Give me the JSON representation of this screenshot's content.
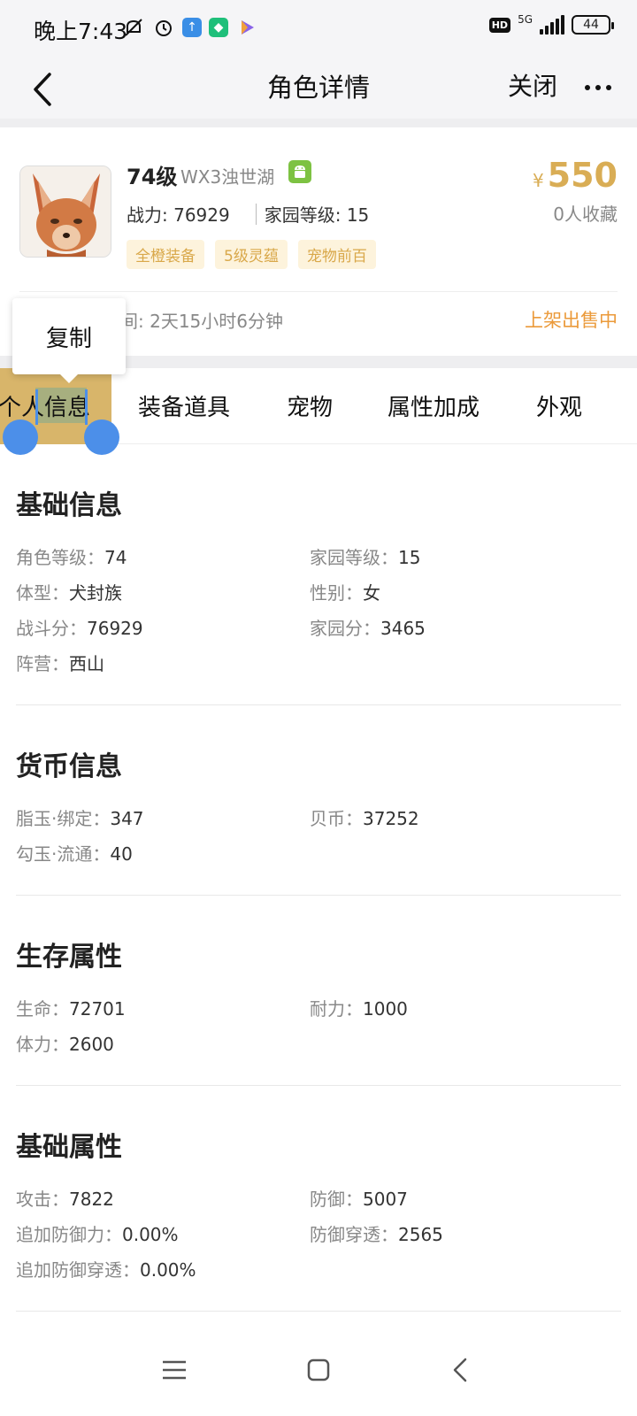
{
  "status_bar": {
    "time": "晚上7:43",
    "hd": "HD",
    "network": "5G",
    "battery": "44"
  },
  "nav": {
    "title": "角色详情",
    "close_label": "关闭"
  },
  "role": {
    "level": "74级",
    "server": "WX3浊世湖",
    "power": "战力: 76929",
    "home_level": "家园等级: 15",
    "tags": [
      "全橙装备",
      "5级灵蕴",
      "宠物前百"
    ],
    "price_symbol": "¥",
    "price": "550",
    "favorites": "0人收藏",
    "listing_time": "间: 2天15小时6分钟",
    "listing_status": "上架出售中"
  },
  "copy_popup": {
    "label": "复制"
  },
  "tabs": {
    "items": [
      "个人信息",
      "装备道具",
      "宠物",
      "属性加成",
      "外观"
    ],
    "active_part1": "个人",
    "active_part2": "信息"
  },
  "sections": [
    {
      "title": "基础信息",
      "rows": [
        [
          {
            "k": "角色等级：",
            "v": "74"
          },
          {
            "k": "家园等级：",
            "v": "15"
          }
        ],
        [
          {
            "k": "体型：",
            "v": "犬封族"
          },
          {
            "k": "性别：",
            "v": "女"
          }
        ],
        [
          {
            "k": "战斗分：",
            "v": "76929"
          },
          {
            "k": "家园分：",
            "v": "3465"
          }
        ],
        [
          {
            "k": "阵营：",
            "v": "西山"
          }
        ]
      ]
    },
    {
      "title": "货币信息",
      "rows": [
        [
          {
            "k": "脂玉·绑定：",
            "v": "347"
          },
          {
            "k": "贝币：",
            "v": "37252"
          }
        ],
        [
          {
            "k": "勾玉·流通：",
            "v": "40"
          }
        ]
      ]
    },
    {
      "title": "生存属性",
      "rows": [
        [
          {
            "k": "生命：",
            "v": "72701"
          },
          {
            "k": "耐力：",
            "v": "1000"
          }
        ],
        [
          {
            "k": "体力：",
            "v": "2600"
          }
        ]
      ]
    },
    {
      "title": "基础属性",
      "rows": [
        [
          {
            "k": "攻击：",
            "v": "7822"
          },
          {
            "k": "防御：",
            "v": "5007"
          }
        ],
        [
          {
            "k": "追加防御力：",
            "v": "0.00%"
          },
          {
            "k": "防御穿透：",
            "v": "2565"
          }
        ],
        [
          {
            "k": "追加防御穿透：",
            "v": "0.00%"
          }
        ]
      ]
    }
  ],
  "colors": {
    "accent_gold": "#d9ad55",
    "status_orange": "#eb9a3a",
    "tab_active_bg": "#d8b56a",
    "selection_blue": "#4c8fe9"
  }
}
